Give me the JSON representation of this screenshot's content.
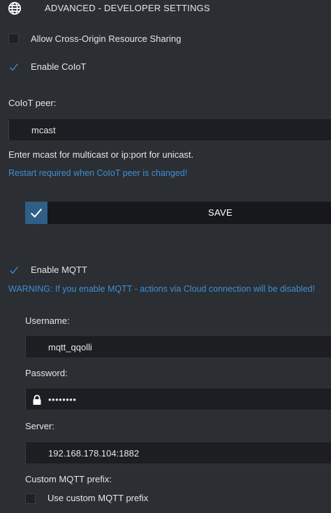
{
  "header": {
    "title": "ADVANCED - DEVELOPER SETTINGS",
    "icon": "globe-icon"
  },
  "cors": {
    "label": "Allow Cross-Origin Resource Sharing",
    "checked": false
  },
  "coiot": {
    "enable_label": "Enable CoIoT",
    "enabled": true,
    "peer_label": "CoIoT peer:",
    "peer_value": "mcast",
    "hint": "Enter mcast for multicast or ip:port for unicast.",
    "restart_note": "Restart required when CoIoT peer is changed!"
  },
  "save": {
    "label": "SAVE"
  },
  "mqtt": {
    "enable_label": "Enable MQTT",
    "enabled": true,
    "warning": "WARNING: If you enable MQTT - actions via Cloud connection will be disabled!",
    "username_label": "Username:",
    "username_value": "mqtt_qqolli",
    "password_label": "Password:",
    "password_value": "••••••••",
    "server_label": "Server:",
    "server_value": "192.168.178.104:1882",
    "prefix_label": "Custom MQTT prefix:",
    "use_prefix_label": "Use custom MQTT prefix",
    "use_prefix_checked": false
  },
  "colors": {
    "accent": "#3f8fd4",
    "save_check_bg": "#2f5f86",
    "background": "#2b2e33"
  }
}
